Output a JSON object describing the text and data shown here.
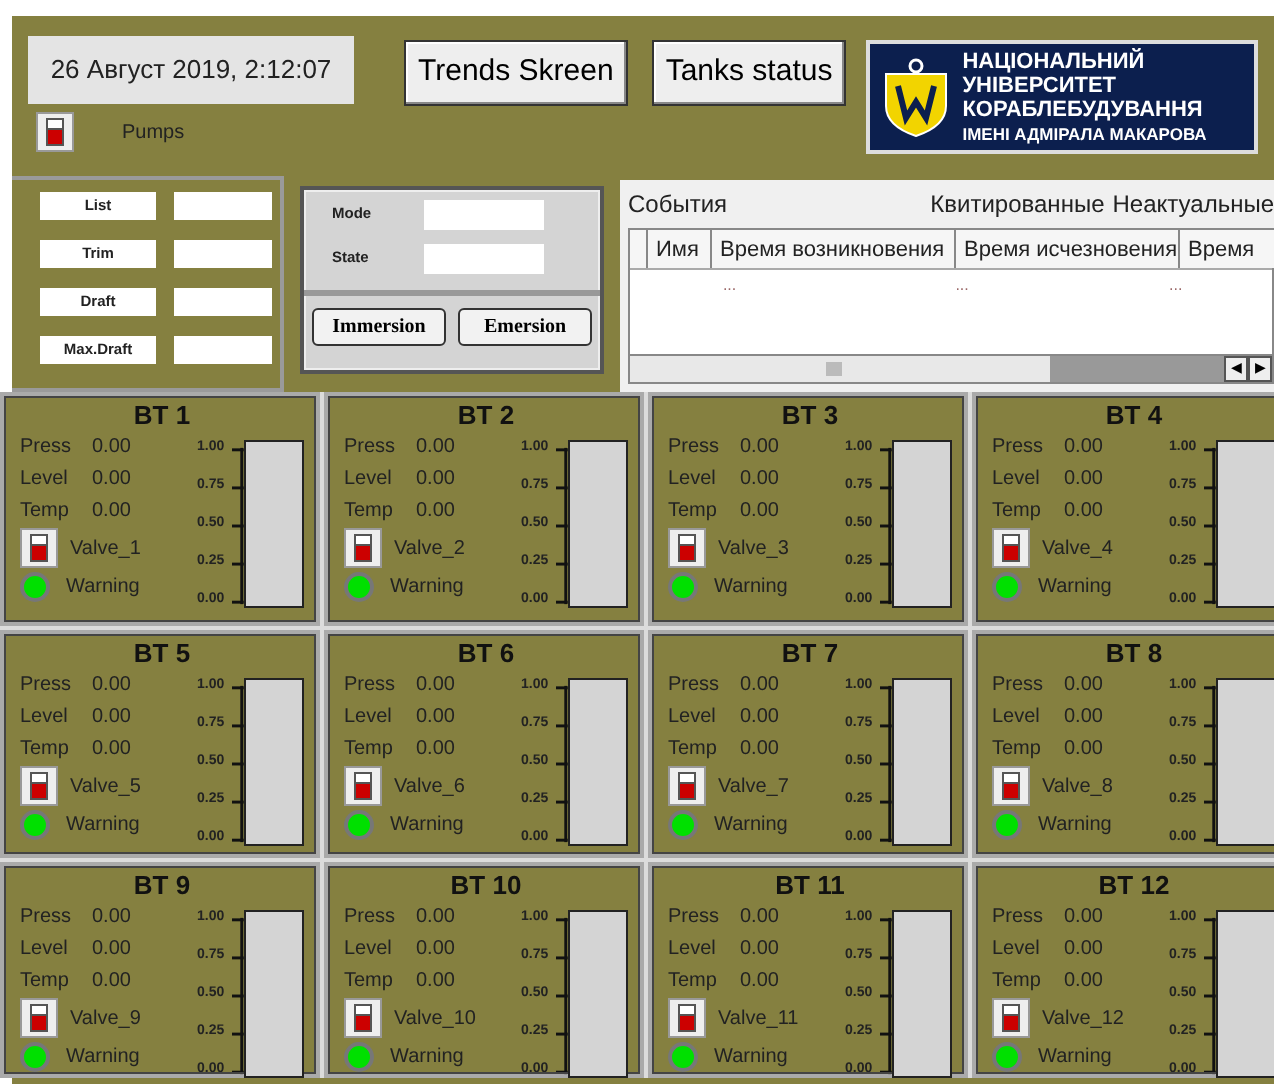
{
  "header": {
    "datetime": "26 Август 2019, 2:12:07",
    "buttons": [
      "Trends Skreen",
      "Tanks status"
    ],
    "pumps": {
      "label": "Pumps",
      "on": false
    },
    "logo": [
      "НАЦІОНАЛЬНИЙ",
      "УНІВЕРСИТЕТ",
      "КОРАБЛЕБУДУВАННЯ",
      "ІМЕНІ АДМІРАЛА МАКАРОВА"
    ]
  },
  "ship_params": [
    {
      "label": "List"
    },
    {
      "label": "Trim"
    },
    {
      "label": "Draft"
    },
    {
      "label": "Max.Draft"
    }
  ],
  "mode_panel": {
    "fields": [
      {
        "label": "Mode"
      },
      {
        "label": "State"
      }
    ],
    "buttons": [
      "Immersion",
      "Emersion"
    ]
  },
  "events": {
    "title": "События",
    "filters": [
      "Квитированные",
      "Неактуальные"
    ],
    "columns": [
      "Имя",
      "Время возникновения",
      "Время исчезновения",
      "Время"
    ],
    "rows": [
      {
        "cells": [
          "",
          "...",
          "...",
          "..."
        ]
      }
    ],
    "scroll_arrows": [
      "◀",
      "▶"
    ]
  },
  "tanks": [
    {
      "title": "BT 1",
      "readings": [
        {
          "label": "Press",
          "value": "0.00"
        },
        {
          "label": "Level",
          "value": "0.00"
        },
        {
          "label": "Temp",
          "value": "0.00"
        }
      ],
      "valve": {
        "label": "Valve_1",
        "on": false
      },
      "warning": {
        "label": "Warning",
        "alarm": false
      },
      "scale": [
        "1.00",
        "0.75",
        "0.50",
        "0.25",
        "0.00"
      ],
      "level": 0
    },
    {
      "title": "BT 2",
      "readings": [
        {
          "label": "Press",
          "value": "0.00"
        },
        {
          "label": "Level",
          "value": "0.00"
        },
        {
          "label": "Temp",
          "value": "0.00"
        }
      ],
      "valve": {
        "label": "Valve_2",
        "on": false
      },
      "warning": {
        "label": "Warning",
        "alarm": false
      },
      "scale": [
        "1.00",
        "0.75",
        "0.50",
        "0.25",
        "0.00"
      ],
      "level": 0
    },
    {
      "title": "BT 3",
      "readings": [
        {
          "label": "Press",
          "value": "0.00"
        },
        {
          "label": "Level",
          "value": "0.00"
        },
        {
          "label": "Temp",
          "value": "0.00"
        }
      ],
      "valve": {
        "label": "Valve_3",
        "on": false
      },
      "warning": {
        "label": "Warning",
        "alarm": false
      },
      "scale": [
        "1.00",
        "0.75",
        "0.50",
        "0.25",
        "0.00"
      ],
      "level": 0
    },
    {
      "title": "BT 4",
      "readings": [
        {
          "label": "Press",
          "value": "0.00"
        },
        {
          "label": "Level",
          "value": "0.00"
        },
        {
          "label": "Temp",
          "value": "0.00"
        }
      ],
      "valve": {
        "label": "Valve_4",
        "on": false
      },
      "warning": {
        "label": "Warning",
        "alarm": false
      },
      "scale": [
        "1.00",
        "0.75",
        "0.50",
        "0.25",
        "0.00"
      ],
      "level": 0
    },
    {
      "title": "BT 5",
      "readings": [
        {
          "label": "Press",
          "value": "0.00"
        },
        {
          "label": "Level",
          "value": "0.00"
        },
        {
          "label": "Temp",
          "value": "0.00"
        }
      ],
      "valve": {
        "label": "Valve_5",
        "on": false
      },
      "warning": {
        "label": "Warning",
        "alarm": false
      },
      "scale": [
        "1.00",
        "0.75",
        "0.50",
        "0.25",
        "0.00"
      ],
      "level": 0
    },
    {
      "title": "BT 6",
      "readings": [
        {
          "label": "Press",
          "value": "0.00"
        },
        {
          "label": "Level",
          "value": "0.00"
        },
        {
          "label": "Temp",
          "value": "0.00"
        }
      ],
      "valve": {
        "label": "Valve_6",
        "on": false
      },
      "warning": {
        "label": "Warning",
        "alarm": false
      },
      "scale": [
        "1.00",
        "0.75",
        "0.50",
        "0.25",
        "0.00"
      ],
      "level": 0
    },
    {
      "title": "BT 7",
      "readings": [
        {
          "label": "Press",
          "value": "0.00"
        },
        {
          "label": "Level",
          "value": "0.00"
        },
        {
          "label": "Temp",
          "value": "0.00"
        }
      ],
      "valve": {
        "label": "Valve_7",
        "on": false
      },
      "warning": {
        "label": "Warning",
        "alarm": false
      },
      "scale": [
        "1.00",
        "0.75",
        "0.50",
        "0.25",
        "0.00"
      ],
      "level": 0
    },
    {
      "title": "BT 8",
      "readings": [
        {
          "label": "Press",
          "value": "0.00"
        },
        {
          "label": "Level",
          "value": "0.00"
        },
        {
          "label": "Temp",
          "value": "0.00"
        }
      ],
      "valve": {
        "label": "Valve_8",
        "on": false
      },
      "warning": {
        "label": "Warning",
        "alarm": false
      },
      "scale": [
        "1.00",
        "0.75",
        "0.50",
        "0.25",
        "0.00"
      ],
      "level": 0
    },
    {
      "title": "BT 9",
      "readings": [
        {
          "label": "Press",
          "value": "0.00"
        },
        {
          "label": "Level",
          "value": "0.00"
        },
        {
          "label": "Temp",
          "value": "0.00"
        }
      ],
      "valve": {
        "label": "Valve_9",
        "on": false
      },
      "warning": {
        "label": "Warning",
        "alarm": false
      },
      "scale": [
        "1.00",
        "0.75",
        "0.50",
        "0.25",
        "0.00"
      ],
      "level": 0
    },
    {
      "title": "BT 10",
      "readings": [
        {
          "label": "Press",
          "value": "0.00"
        },
        {
          "label": "Level",
          "value": "0.00"
        },
        {
          "label": "Temp",
          "value": "0.00"
        }
      ],
      "valve": {
        "label": "Valve_10",
        "on": false
      },
      "warning": {
        "label": "Warning",
        "alarm": false
      },
      "scale": [
        "1.00",
        "0.75",
        "0.50",
        "0.25",
        "0.00"
      ],
      "level": 0
    },
    {
      "title": "BT 11",
      "readings": [
        {
          "label": "Press",
          "value": "0.00"
        },
        {
          "label": "Level",
          "value": "0.00"
        },
        {
          "label": "Temp",
          "value": "0.00"
        }
      ],
      "valve": {
        "label": "Valve_11",
        "on": false
      },
      "warning": {
        "label": "Warning",
        "alarm": false
      },
      "scale": [
        "1.00",
        "0.75",
        "0.50",
        "0.25",
        "0.00"
      ],
      "level": 0
    },
    {
      "title": "BT 12",
      "readings": [
        {
          "label": "Press",
          "value": "0.00"
        },
        {
          "label": "Level",
          "value": "0.00"
        },
        {
          "label": "Temp",
          "value": "0.00"
        }
      ],
      "valve": {
        "label": "Valve_12",
        "on": false
      },
      "warning": {
        "label": "Warning",
        "alarm": false
      },
      "scale": [
        "1.00",
        "0.75",
        "0.50",
        "0.25",
        "0.00"
      ],
      "level": 0
    }
  ]
}
